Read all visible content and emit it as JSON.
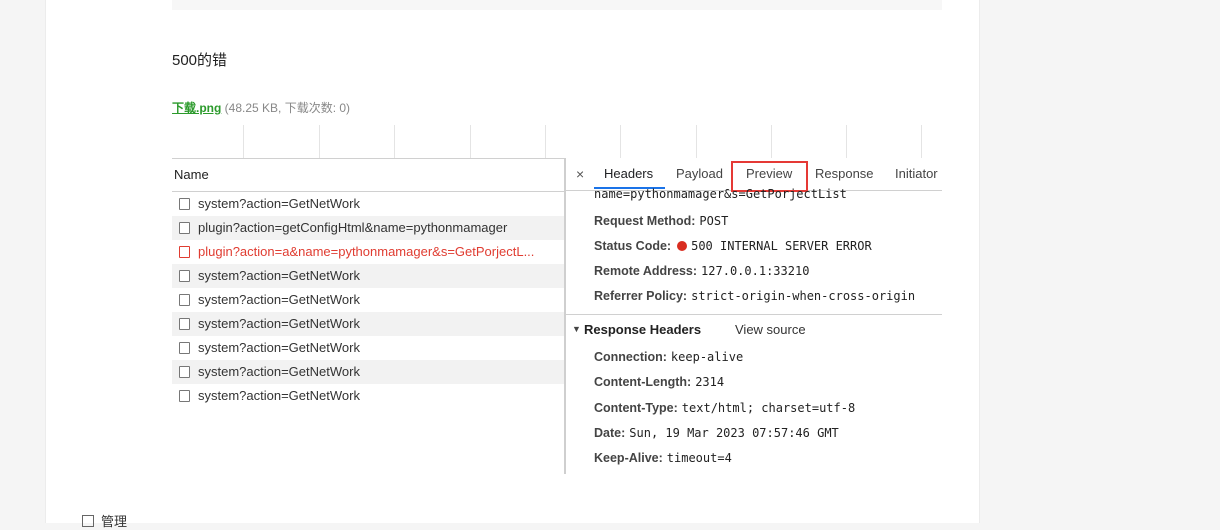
{
  "post": {
    "text": "500的错",
    "attachment": {
      "filename": "下载.png",
      "meta": "(48.25 KB, 下载次数: 0)"
    }
  },
  "devtools": {
    "name_header": "Name",
    "requests": [
      {
        "label": "system?action=GetNetWork",
        "error": false
      },
      {
        "label": "plugin?action=getConfigHtml&name=pythonmamager",
        "error": false
      },
      {
        "label": "plugin?action=a&name=pythonmamager&s=GetPorjectL...",
        "error": true
      },
      {
        "label": "system?action=GetNetWork",
        "error": false
      },
      {
        "label": "system?action=GetNetWork",
        "error": false
      },
      {
        "label": "system?action=GetNetWork",
        "error": false
      },
      {
        "label": "system?action=GetNetWork",
        "error": false
      },
      {
        "label": "system?action=GetNetWork",
        "error": false
      },
      {
        "label": "system?action=GetNetWork",
        "error": false
      }
    ],
    "tabs": [
      "Headers",
      "Payload",
      "Preview",
      "Response",
      "Initiator"
    ],
    "close_glyph": "×",
    "general": {
      "truncated_line": "name=pythonmamager&s=GetPorjectList",
      "request_method": {
        "key": "Request Method:",
        "value": "POST"
      },
      "status_code": {
        "key": "Status Code:",
        "value": "500 INTERNAL SERVER ERROR"
      },
      "remote_address": {
        "key": "Remote Address:",
        "value": "127.0.0.1:33210"
      },
      "referrer_policy": {
        "key": "Referrer Policy:",
        "value": "strict-origin-when-cross-origin"
      }
    },
    "response_headers": {
      "title": "Response Headers",
      "view_source": "View source",
      "connection": {
        "key": "Connection:",
        "value": "keep-alive"
      },
      "content_length": {
        "key": "Content-Length:",
        "value": "2314"
      },
      "content_type": {
        "key": "Content-Type:",
        "value": "text/html; charset=utf-8"
      },
      "date": {
        "key": "Date:",
        "value": "Sun, 19 Mar 2023 07:57:46 GMT"
      },
      "keep_alive": {
        "key": "Keep-Alive:",
        "value": "timeout=4"
      }
    }
  },
  "footer": {
    "manage_label": "管理"
  },
  "colors": {
    "accent": "#1a73e8",
    "error": "#e03c31",
    "highlight_box": "#e53935",
    "link_green": "#2b9a2b"
  },
  "icons": {
    "status_dot": "red-status-dot-icon",
    "close": "close-icon",
    "collapse": "triangle-down-icon"
  }
}
